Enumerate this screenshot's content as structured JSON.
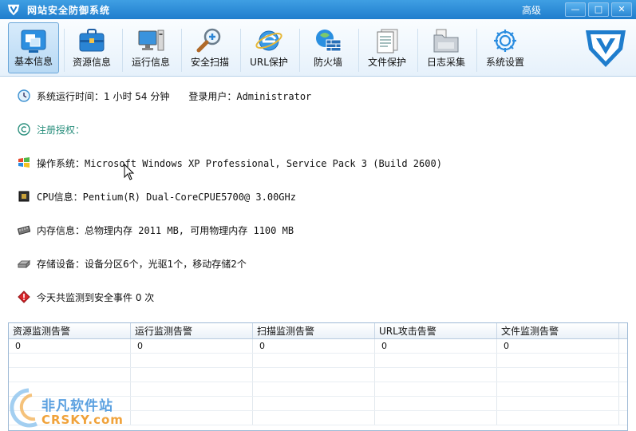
{
  "window": {
    "title": "网站安全防御系统",
    "advanced_label": "高级",
    "buttons": {
      "minimize": "—",
      "maximize": "□",
      "close": "✕"
    }
  },
  "toolbar": {
    "items": [
      {
        "label": "基本信息",
        "icon": "basic-info-icon",
        "active": true
      },
      {
        "label": "资源信息",
        "icon": "briefcase-icon"
      },
      {
        "label": "运行信息",
        "icon": "computer-icon"
      },
      {
        "label": "安全扫描",
        "icon": "magnifier-icon"
      },
      {
        "label": "URL保护",
        "icon": "ie-globe-icon"
      },
      {
        "label": "防火墙",
        "icon": "firewall-icon"
      },
      {
        "label": "文件保护",
        "icon": "document-icon"
      },
      {
        "label": "日志采集",
        "icon": "folder-icon"
      },
      {
        "label": "系统设置",
        "icon": "gear-icon"
      }
    ],
    "accent": "#1f7dcd"
  },
  "info": {
    "uptime": "系统运行时间：1 小时 54 分钟",
    "login_user": "登录用户：Administrator",
    "license": "注册授权：",
    "os": "操作系统：Microsoft Windows XP Professional, Service Pack 3 (Build 2600)",
    "cpu": "CPU信息：Pentium(R) Dual-CoreCPUE5700@ 3.00GHz",
    "memory": "内存信息：总物理内存 2011 MB, 可用物理内存 1100 MB",
    "storage": "存储设备：设备分区6个，光驱1个，移动存储2个",
    "events": "今天共监测到安全事件 0 次"
  },
  "alerts_table": {
    "columns": [
      "资源监测告警",
      "运行监测告警",
      "扫描监测告警",
      "URL攻击告警",
      "文件监测告警"
    ],
    "rows": [
      [
        "0",
        "0",
        "0",
        "0",
        "0"
      ]
    ]
  },
  "watermark": {
    "cn": "非凡软件站",
    "en": "CRSKY.com"
  }
}
